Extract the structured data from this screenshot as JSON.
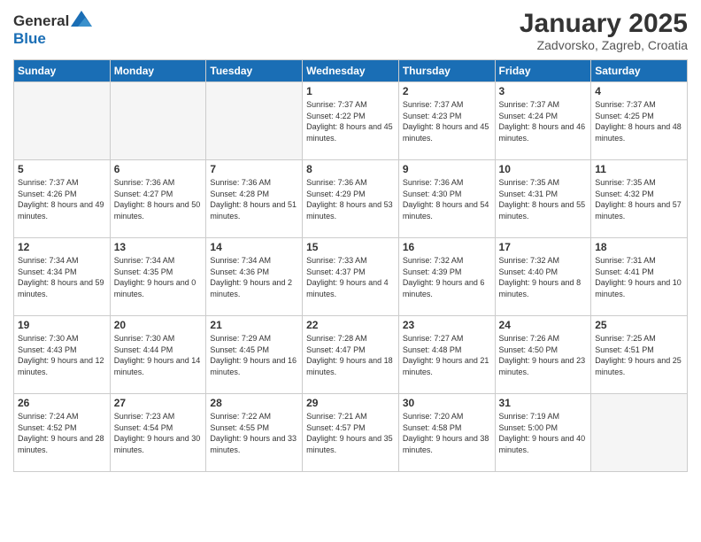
{
  "header": {
    "logo_general": "General",
    "logo_blue": "Blue",
    "month_title": "January 2025",
    "subtitle": "Zadvorsko, Zagreb, Croatia"
  },
  "weekdays": [
    "Sunday",
    "Monday",
    "Tuesday",
    "Wednesday",
    "Thursday",
    "Friday",
    "Saturday"
  ],
  "weeks": [
    [
      {
        "day": "",
        "sunrise": "",
        "sunset": "",
        "daylight": "",
        "empty": true
      },
      {
        "day": "",
        "sunrise": "",
        "sunset": "",
        "daylight": "",
        "empty": true
      },
      {
        "day": "",
        "sunrise": "",
        "sunset": "",
        "daylight": "",
        "empty": true
      },
      {
        "day": "1",
        "sunrise": "Sunrise: 7:37 AM",
        "sunset": "Sunset: 4:22 PM",
        "daylight": "Daylight: 8 hours and 45 minutes."
      },
      {
        "day": "2",
        "sunrise": "Sunrise: 7:37 AM",
        "sunset": "Sunset: 4:23 PM",
        "daylight": "Daylight: 8 hours and 45 minutes."
      },
      {
        "day": "3",
        "sunrise": "Sunrise: 7:37 AM",
        "sunset": "Sunset: 4:24 PM",
        "daylight": "Daylight: 8 hours and 46 minutes."
      },
      {
        "day": "4",
        "sunrise": "Sunrise: 7:37 AM",
        "sunset": "Sunset: 4:25 PM",
        "daylight": "Daylight: 8 hours and 48 minutes."
      }
    ],
    [
      {
        "day": "5",
        "sunrise": "Sunrise: 7:37 AM",
        "sunset": "Sunset: 4:26 PM",
        "daylight": "Daylight: 8 hours and 49 minutes."
      },
      {
        "day": "6",
        "sunrise": "Sunrise: 7:36 AM",
        "sunset": "Sunset: 4:27 PM",
        "daylight": "Daylight: 8 hours and 50 minutes."
      },
      {
        "day": "7",
        "sunrise": "Sunrise: 7:36 AM",
        "sunset": "Sunset: 4:28 PM",
        "daylight": "Daylight: 8 hours and 51 minutes."
      },
      {
        "day": "8",
        "sunrise": "Sunrise: 7:36 AM",
        "sunset": "Sunset: 4:29 PM",
        "daylight": "Daylight: 8 hours and 53 minutes."
      },
      {
        "day": "9",
        "sunrise": "Sunrise: 7:36 AM",
        "sunset": "Sunset: 4:30 PM",
        "daylight": "Daylight: 8 hours and 54 minutes."
      },
      {
        "day": "10",
        "sunrise": "Sunrise: 7:35 AM",
        "sunset": "Sunset: 4:31 PM",
        "daylight": "Daylight: 8 hours and 55 minutes."
      },
      {
        "day": "11",
        "sunrise": "Sunrise: 7:35 AM",
        "sunset": "Sunset: 4:32 PM",
        "daylight": "Daylight: 8 hours and 57 minutes."
      }
    ],
    [
      {
        "day": "12",
        "sunrise": "Sunrise: 7:34 AM",
        "sunset": "Sunset: 4:34 PM",
        "daylight": "Daylight: 8 hours and 59 minutes."
      },
      {
        "day": "13",
        "sunrise": "Sunrise: 7:34 AM",
        "sunset": "Sunset: 4:35 PM",
        "daylight": "Daylight: 9 hours and 0 minutes."
      },
      {
        "day": "14",
        "sunrise": "Sunrise: 7:34 AM",
        "sunset": "Sunset: 4:36 PM",
        "daylight": "Daylight: 9 hours and 2 minutes."
      },
      {
        "day": "15",
        "sunrise": "Sunrise: 7:33 AM",
        "sunset": "Sunset: 4:37 PM",
        "daylight": "Daylight: 9 hours and 4 minutes."
      },
      {
        "day": "16",
        "sunrise": "Sunrise: 7:32 AM",
        "sunset": "Sunset: 4:39 PM",
        "daylight": "Daylight: 9 hours and 6 minutes."
      },
      {
        "day": "17",
        "sunrise": "Sunrise: 7:32 AM",
        "sunset": "Sunset: 4:40 PM",
        "daylight": "Daylight: 9 hours and 8 minutes."
      },
      {
        "day": "18",
        "sunrise": "Sunrise: 7:31 AM",
        "sunset": "Sunset: 4:41 PM",
        "daylight": "Daylight: 9 hours and 10 minutes."
      }
    ],
    [
      {
        "day": "19",
        "sunrise": "Sunrise: 7:30 AM",
        "sunset": "Sunset: 4:43 PM",
        "daylight": "Daylight: 9 hours and 12 minutes."
      },
      {
        "day": "20",
        "sunrise": "Sunrise: 7:30 AM",
        "sunset": "Sunset: 4:44 PM",
        "daylight": "Daylight: 9 hours and 14 minutes."
      },
      {
        "day": "21",
        "sunrise": "Sunrise: 7:29 AM",
        "sunset": "Sunset: 4:45 PM",
        "daylight": "Daylight: 9 hours and 16 minutes."
      },
      {
        "day": "22",
        "sunrise": "Sunrise: 7:28 AM",
        "sunset": "Sunset: 4:47 PM",
        "daylight": "Daylight: 9 hours and 18 minutes."
      },
      {
        "day": "23",
        "sunrise": "Sunrise: 7:27 AM",
        "sunset": "Sunset: 4:48 PM",
        "daylight": "Daylight: 9 hours and 21 minutes."
      },
      {
        "day": "24",
        "sunrise": "Sunrise: 7:26 AM",
        "sunset": "Sunset: 4:50 PM",
        "daylight": "Daylight: 9 hours and 23 minutes."
      },
      {
        "day": "25",
        "sunrise": "Sunrise: 7:25 AM",
        "sunset": "Sunset: 4:51 PM",
        "daylight": "Daylight: 9 hours and 25 minutes."
      }
    ],
    [
      {
        "day": "26",
        "sunrise": "Sunrise: 7:24 AM",
        "sunset": "Sunset: 4:52 PM",
        "daylight": "Daylight: 9 hours and 28 minutes."
      },
      {
        "day": "27",
        "sunrise": "Sunrise: 7:23 AM",
        "sunset": "Sunset: 4:54 PM",
        "daylight": "Daylight: 9 hours and 30 minutes."
      },
      {
        "day": "28",
        "sunrise": "Sunrise: 7:22 AM",
        "sunset": "Sunset: 4:55 PM",
        "daylight": "Daylight: 9 hours and 33 minutes."
      },
      {
        "day": "29",
        "sunrise": "Sunrise: 7:21 AM",
        "sunset": "Sunset: 4:57 PM",
        "daylight": "Daylight: 9 hours and 35 minutes."
      },
      {
        "day": "30",
        "sunrise": "Sunrise: 7:20 AM",
        "sunset": "Sunset: 4:58 PM",
        "daylight": "Daylight: 9 hours and 38 minutes."
      },
      {
        "day": "31",
        "sunrise": "Sunrise: 7:19 AM",
        "sunset": "Sunset: 5:00 PM",
        "daylight": "Daylight: 9 hours and 40 minutes."
      },
      {
        "day": "",
        "sunrise": "",
        "sunset": "",
        "daylight": "",
        "empty": true
      }
    ]
  ]
}
